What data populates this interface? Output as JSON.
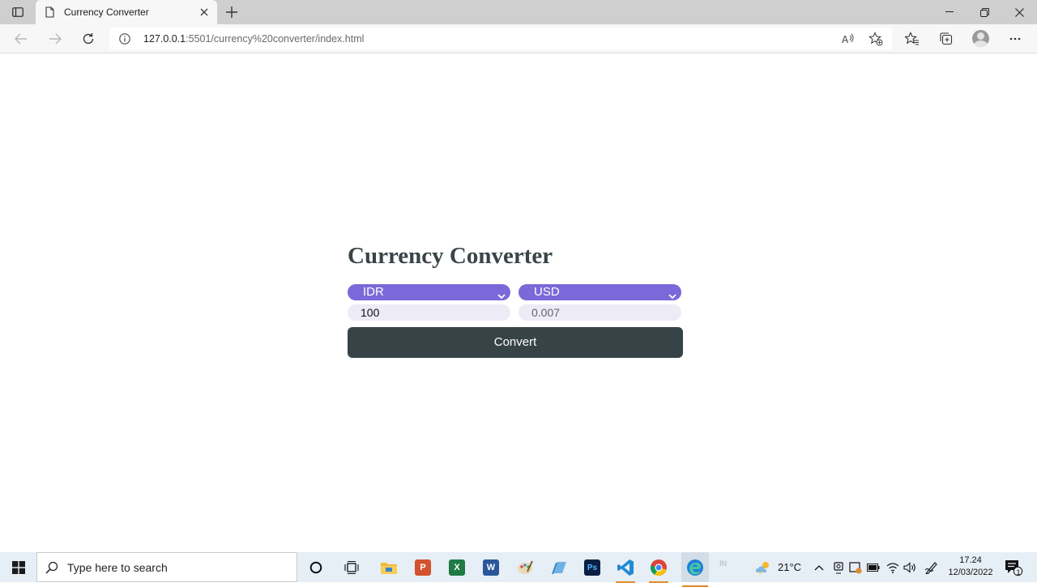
{
  "browser": {
    "tab": {
      "title": "Currency Converter"
    },
    "address": {
      "host": "127.0.0.1",
      "path": ":5501/currency%20converter/index.html"
    }
  },
  "page": {
    "title": "Currency Converter",
    "from_currency": "IDR",
    "to_currency": "USD",
    "from_amount": "100",
    "to_amount": "0.007",
    "convert_label": "Convert",
    "colors": {
      "select_bg": "#7b68d9",
      "input_bg": "#ecebf6",
      "button_bg": "#374447"
    }
  },
  "taskbar": {
    "search_placeholder": "Type here to search",
    "apps": [
      "task-view",
      "file-explorer",
      "powerpoint",
      "excel",
      "word",
      "paint",
      "notes",
      "photoshop",
      "vscode",
      "chrome",
      "edge"
    ],
    "language": "IN",
    "temperature": "21°C",
    "time": "17.24",
    "date": "12/03/2022",
    "notification_count": "1"
  }
}
